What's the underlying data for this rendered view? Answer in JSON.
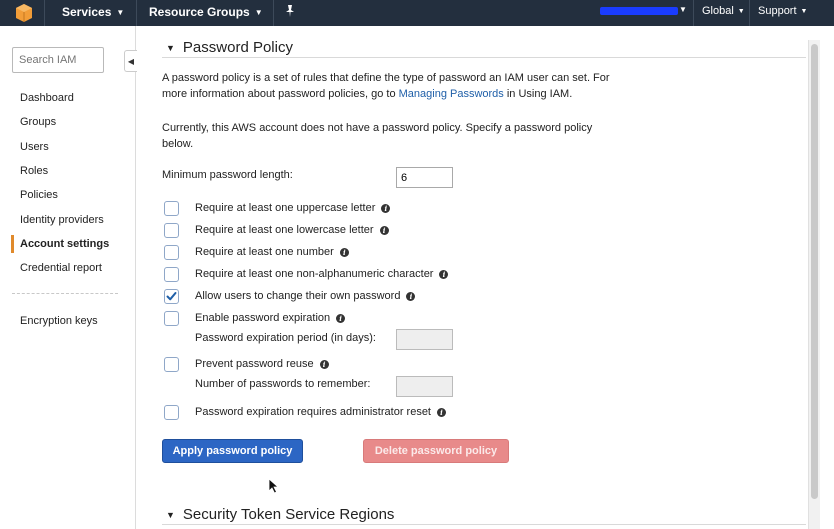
{
  "topbar": {
    "logo_icon": "aws-cube-icon",
    "services_label": "Services",
    "resource_groups_label": "Resource Groups",
    "pin_icon": "pushpin-icon",
    "region_label": "Global",
    "support_label": "Support"
  },
  "sidebar": {
    "search_placeholder": "Search IAM",
    "items": [
      {
        "label": "Dashboard"
      },
      {
        "label": "Groups"
      },
      {
        "label": "Users"
      },
      {
        "label": "Roles"
      },
      {
        "label": "Policies"
      },
      {
        "label": "Identity providers"
      },
      {
        "label": "Account settings",
        "active": true
      },
      {
        "label": "Credential report"
      }
    ],
    "encryption_label": "Encryption keys"
  },
  "password_policy": {
    "heading": "Password Policy",
    "intro_text_before_link": "A password policy is a set of rules that define the type of password an IAM user can set. For more information about password policies, go to ",
    "intro_link": "Managing Passwords",
    "intro_text_after_link": " in Using IAM.",
    "status_text": "Currently, this AWS account does not have a password policy. Specify a password policy below.",
    "min_length_label": "Minimum password length:",
    "min_length_value": "6",
    "options": [
      {
        "label": "Require at least one uppercase letter",
        "checked": false
      },
      {
        "label": "Require at least one lowercase letter",
        "checked": false
      },
      {
        "label": "Require at least one number",
        "checked": false
      },
      {
        "label": "Require at least one non-alphanumeric character",
        "checked": false
      },
      {
        "label": "Allow users to change their own password",
        "checked": true
      },
      {
        "label": "Enable password expiration",
        "checked": false
      },
      {
        "label": "Prevent password reuse",
        "checked": false
      },
      {
        "label": "Password expiration requires administrator reset",
        "checked": false
      }
    ],
    "expiration_period_label": "Password expiration period (in days):",
    "expiration_period_value": "",
    "remember_label": "Number of passwords to remember:",
    "remember_value": "",
    "apply_button": "Apply password policy",
    "delete_button": "Delete password policy"
  },
  "sts_section": {
    "heading": "Security Token Service Regions"
  },
  "colors": {
    "topbar_bg": "#232f3e",
    "primary_button": "#2c66c4",
    "danger_button_disabled": "#e88a8a",
    "active_marker": "#e08a2c",
    "link": "#1f5fa8"
  }
}
